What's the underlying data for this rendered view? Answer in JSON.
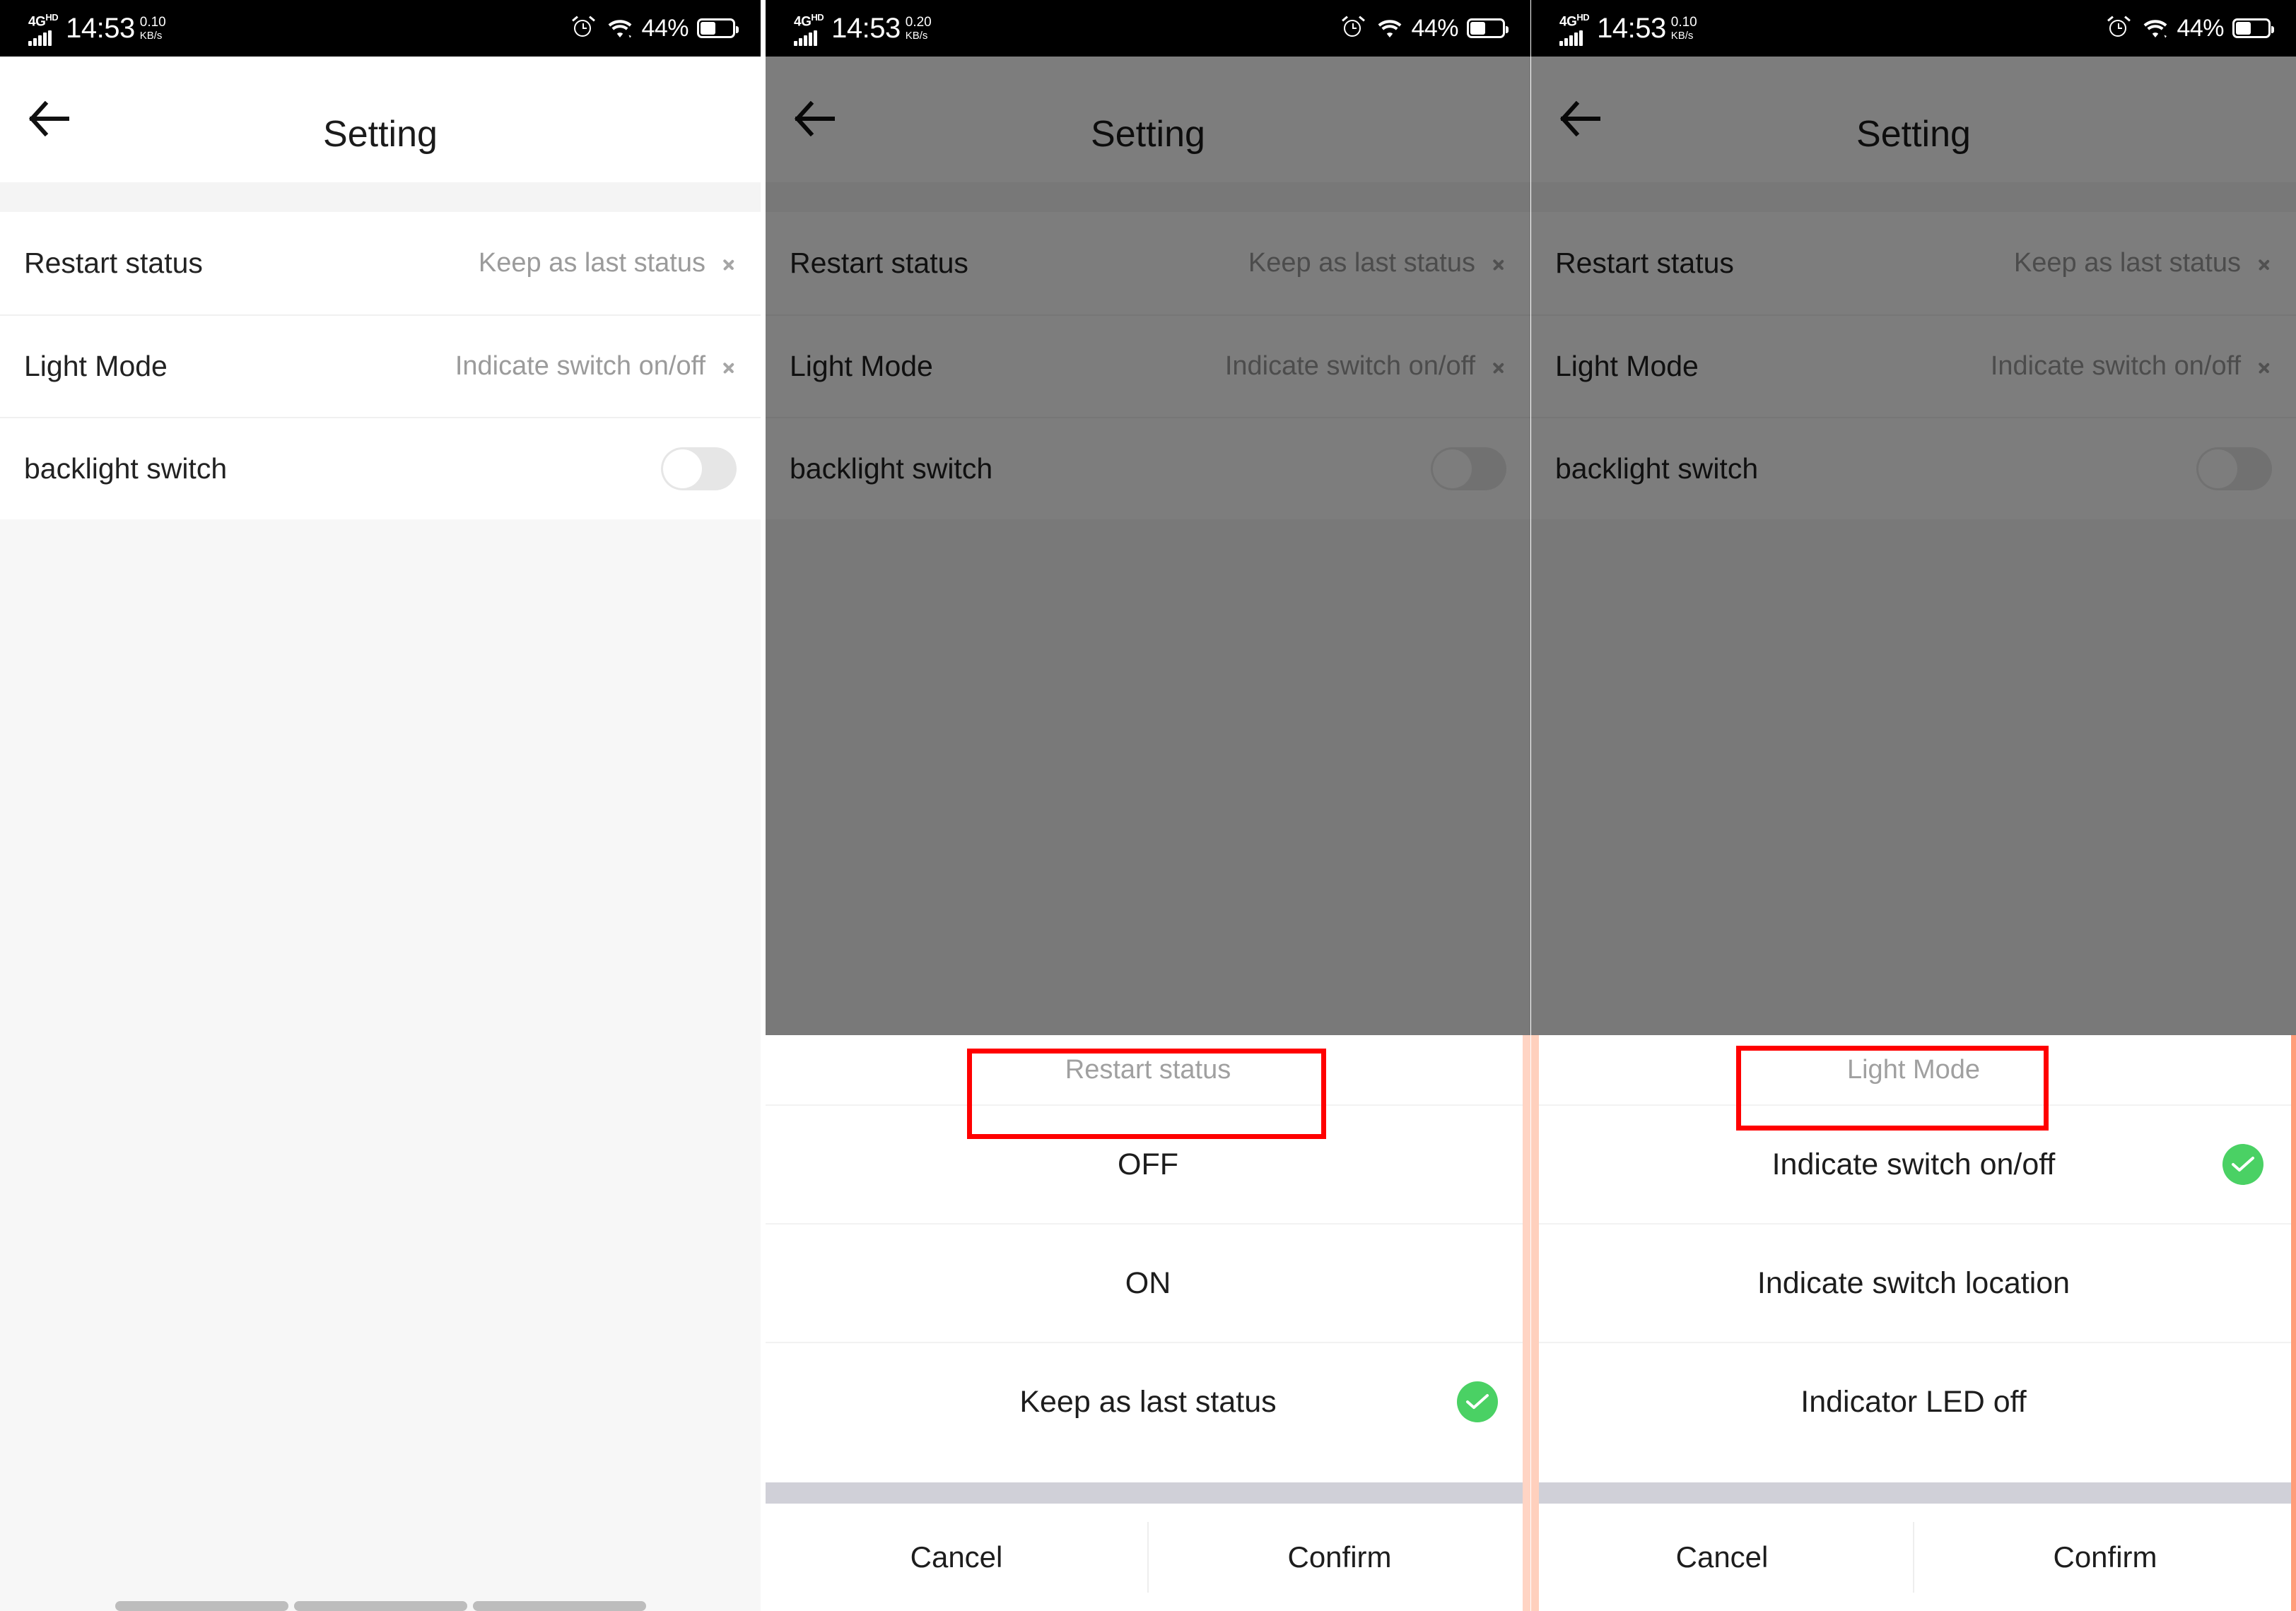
{
  "panels": [
    {
      "id": "settings-list",
      "statusbar": {
        "network_type": "4G",
        "network_hd": "HD",
        "clock": "14:53",
        "speed_value": "0.10",
        "speed_unit": "KB/s",
        "battery_percent": "44%",
        "icons": [
          "signal-bars-icon",
          "alarm-clock-icon",
          "wifi-icon",
          "battery-icon"
        ]
      },
      "header": {
        "back_icon": "back-arrow-icon",
        "title": "Setting"
      },
      "rows": [
        {
          "label": "Restart status",
          "value": "Keep as last status",
          "type": "chevron"
        },
        {
          "label": "Light Mode",
          "value": "Indicate switch on/off",
          "type": "chevron"
        },
        {
          "label": "backlight switch",
          "value": "",
          "type": "toggle",
          "toggle_on": false
        }
      ],
      "sheet": null
    },
    {
      "id": "restart-status-picker",
      "statusbar": {
        "network_type": "4G",
        "network_hd": "HD",
        "clock": "14:53",
        "speed_value": "0.20",
        "speed_unit": "KB/s",
        "battery_percent": "44%",
        "icons": [
          "signal-bars-icon",
          "alarm-clock-icon",
          "wifi-icon",
          "battery-icon"
        ]
      },
      "header": {
        "back_icon": "back-arrow-icon",
        "title": "Setting"
      },
      "rows": [
        {
          "label": "Restart status",
          "value": "Keep as last status",
          "type": "chevron"
        },
        {
          "label": "Light Mode",
          "value": "Indicate switch on/off",
          "type": "chevron"
        },
        {
          "label": "backlight switch",
          "value": "",
          "type": "toggle",
          "toggle_on": false
        }
      ],
      "sheet": {
        "title": "Restart status",
        "highlighted": true,
        "options": [
          {
            "label": "OFF",
            "selected": false
          },
          {
            "label": "ON",
            "selected": false
          },
          {
            "label": "Keep as last status",
            "selected": true
          }
        ],
        "cancel_label": "Cancel",
        "confirm_label": "Confirm"
      }
    },
    {
      "id": "light-mode-picker",
      "statusbar": {
        "network_type": "4G",
        "network_hd": "HD",
        "clock": "14:53",
        "speed_value": "0.10",
        "speed_unit": "KB/s",
        "battery_percent": "44%",
        "icons": [
          "signal-bars-icon",
          "alarm-clock-icon",
          "wifi-icon",
          "battery-icon"
        ]
      },
      "header": {
        "back_icon": "back-arrow-icon",
        "title": "Setting"
      },
      "rows": [
        {
          "label": "Restart status",
          "value": "Keep as last status",
          "type": "chevron"
        },
        {
          "label": "Light Mode",
          "value": "Indicate switch on/off",
          "type": "chevron"
        },
        {
          "label": "backlight switch",
          "value": "",
          "type": "toggle",
          "toggle_on": false
        }
      ],
      "sheet": {
        "title": "Light Mode",
        "highlighted": true,
        "options": [
          {
            "label": "Indicate switch on/off",
            "selected": true
          },
          {
            "label": "Indicate switch location",
            "selected": false
          },
          {
            "label": "Indicator LED off",
            "selected": false
          }
        ],
        "cancel_label": "Cancel",
        "confirm_label": "Confirm"
      }
    }
  ],
  "colors": {
    "accent_green": "#4ad164",
    "annotation_red": "#ff0000",
    "dim_overlay": "#7d7d7d",
    "toggle_track_off": "#e6e6e6",
    "value_text": "#9b9b9b"
  }
}
